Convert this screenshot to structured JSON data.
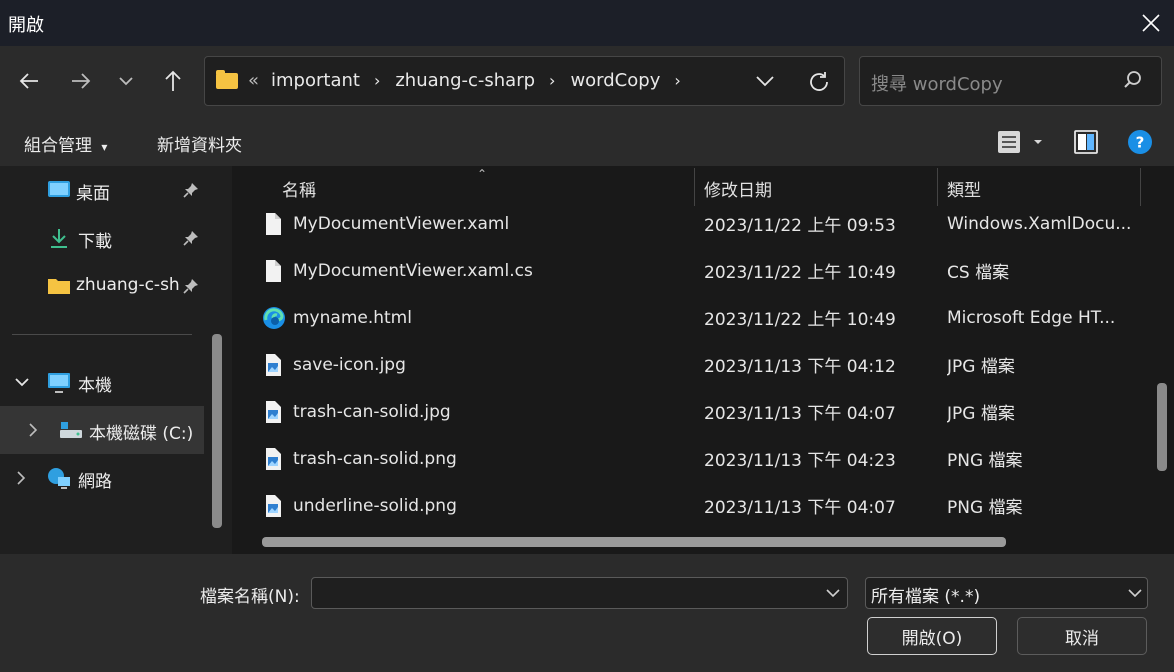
{
  "window": {
    "title": "開啟"
  },
  "address": {
    "prefix": "«",
    "crumbs": [
      "important",
      "zhuang-c-sharp",
      "wordCopy"
    ]
  },
  "search": {
    "placeholder": "搜尋 wordCopy"
  },
  "toolbar": {
    "organize": "組合管理",
    "new_folder": "新增資料夾"
  },
  "nav": {
    "items": [
      {
        "label": "桌面",
        "icon": "desktop-icon",
        "pinned": true
      },
      {
        "label": "下載",
        "icon": "download-icon",
        "pinned": true
      },
      {
        "label": "zhuang-c-sh",
        "icon": "folder-icon",
        "pinned": true
      },
      {
        "label": "本機",
        "icon": "computer-icon"
      },
      {
        "label": "本機磁碟 (C:)",
        "icon": "drive-icon"
      },
      {
        "label": "網路",
        "icon": "network-icon"
      }
    ]
  },
  "columns": {
    "name": "名稱",
    "date": "修改日期",
    "type": "類型"
  },
  "files": [
    {
      "name": "MyDocumentViewer.xaml",
      "date": "2023/11/22 上午 09:53",
      "type": "Windows.XamlDocu...",
      "icon": "file-icon"
    },
    {
      "name": "MyDocumentViewer.xaml.cs",
      "date": "2023/11/22 上午 10:49",
      "type": "CS 檔案",
      "icon": "file-icon"
    },
    {
      "name": "myname.html",
      "date": "2023/11/22 上午 10:49",
      "type": "Microsoft Edge HT...",
      "icon": "edge-icon"
    },
    {
      "name": "save-icon.jpg",
      "date": "2023/11/13 下午 04:12",
      "type": "JPG 檔案",
      "icon": "image-file-icon"
    },
    {
      "name": "trash-can-solid.jpg",
      "date": "2023/11/13 下午 04:07",
      "type": "JPG 檔案",
      "icon": "image-file-icon"
    },
    {
      "name": "trash-can-solid.png",
      "date": "2023/11/13 下午 04:23",
      "type": "PNG 檔案",
      "icon": "image-file-icon"
    },
    {
      "name": "underline-solid.png",
      "date": "2023/11/13 下午 04:07",
      "type": "PNG 檔案",
      "icon": "image-file-icon"
    }
  ],
  "bottom": {
    "filename_label": "檔案名稱(N):",
    "filename_value": "",
    "filetype_selected": "所有檔案 (*.*)",
    "open_button": "開啟(O)",
    "cancel_button": "取消"
  },
  "colors": {
    "accent_blue": "#1a8fe6",
    "folder_yellow": "#f5c342",
    "background": "#202020"
  }
}
